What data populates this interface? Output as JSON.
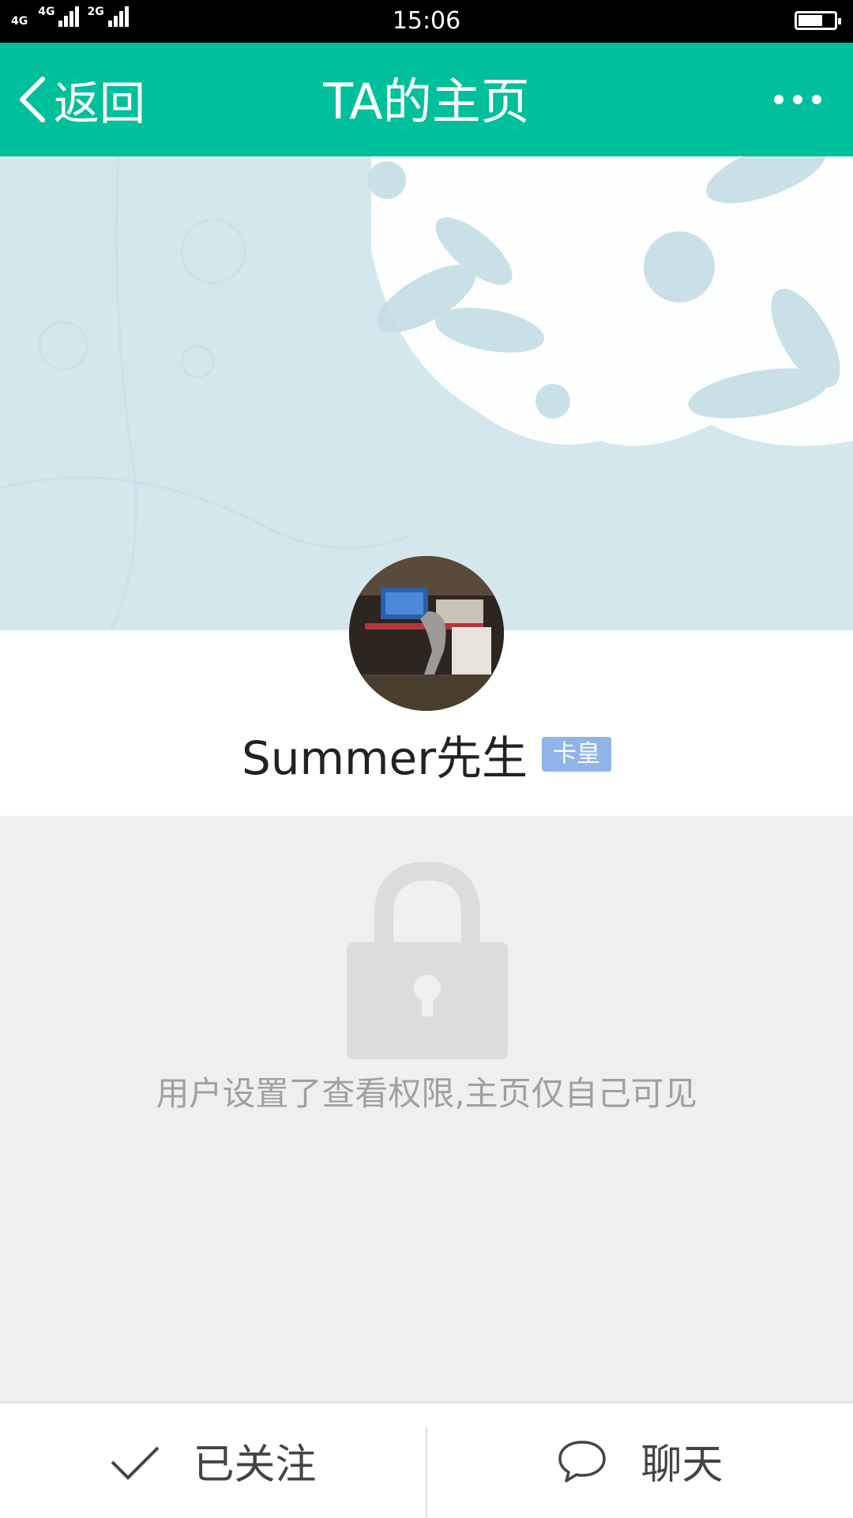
{
  "status_bar": {
    "net1": "4G",
    "net2": "4G",
    "net3": "2G",
    "time": "15:06",
    "battery_level": 0.7
  },
  "header": {
    "back_label": "返回",
    "title": "TA的主页",
    "more_icon": "more-dots-icon"
  },
  "profile": {
    "name": "Summer先生",
    "badge": "卡皇"
  },
  "content": {
    "lock_icon": "lock-icon",
    "message": "用户设置了查看权限,主页仅自己可见"
  },
  "bottom": {
    "follow_label": "已关注",
    "chat_label": "聊天"
  },
  "colors": {
    "accent": "#00bf9b",
    "badge": "#8fb5e8"
  }
}
